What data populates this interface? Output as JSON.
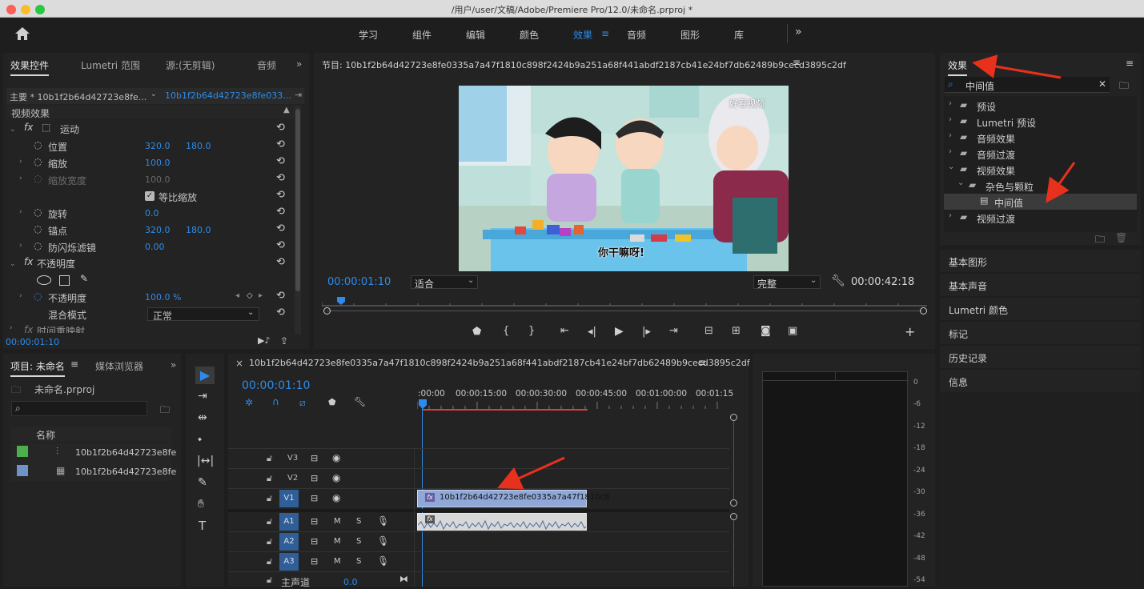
{
  "window": {
    "title": "/用户/user/文稿/Adobe/Premiere Pro/12.0/未命名.prproj *"
  },
  "workspaces": {
    "items": [
      "学习",
      "组件",
      "编辑",
      "颜色",
      "效果",
      "音频",
      "图形",
      "库"
    ],
    "active": "效果",
    "more": "»"
  },
  "effect_controls": {
    "tabs": [
      "效果控件",
      "Lumetri 范围",
      "源:(无剪辑)",
      "音频"
    ],
    "master_label": "主要 * 10b1f2b64d42723e8fe...",
    "clip_label": "10b1f2b64d42723e8fe033...",
    "video_effects": "视频效果",
    "motion": "运动",
    "position": {
      "label": "位置",
      "x": "320.0",
      "y": "180.0"
    },
    "scale": {
      "label": "缩放",
      "value": "100.0"
    },
    "scale_width": {
      "label": "缩放宽度",
      "value": "100.0"
    },
    "uniform_scale": "等比缩放",
    "rotation": {
      "label": "旋转",
      "value": "0.0"
    },
    "anchor": {
      "label": "锚点",
      "x": "320.0",
      "y": "180.0"
    },
    "flicker": {
      "label": "防闪烁滤镜",
      "value": "0.00"
    },
    "opacity_group": "不透明度",
    "opacity": {
      "label": "不透明度",
      "value": "100.0 %"
    },
    "blend": {
      "label": "混合模式",
      "value": "正常"
    },
    "time_remap": "时间重映射",
    "timecode": "00:00:01:10"
  },
  "program": {
    "title": "节目: 10b1f2b64d42723e8fe0335a7a47f1810c898f2424b9a251a68f441abdf2187cb41e24bf7db62489b9cecd3895c2df",
    "timecode": "00:00:01:10",
    "fit": "适合",
    "quality": "完整",
    "duration": "00:00:42:18",
    "subtitle": "你干嘛呀!",
    "watermark": "好看视频"
  },
  "effects_panel": {
    "title": "效果",
    "search": "中间值",
    "tree": [
      {
        "label": "预设",
        "level": 0
      },
      {
        "label": "Lumetri 预设",
        "level": 0
      },
      {
        "label": "音频效果",
        "level": 0
      },
      {
        "label": "音频过渡",
        "level": 0
      },
      {
        "label": "视频效果",
        "level": 0,
        "open": true
      },
      {
        "label": "杂色与颗粒",
        "level": 1,
        "open": true
      },
      {
        "label": "中间值",
        "level": 2,
        "selected": true
      },
      {
        "label": "视频过渡",
        "level": 0
      }
    ],
    "sections": [
      "基本图形",
      "基本声音",
      "Lumetri 颜色",
      "标记",
      "历史记录",
      "信息"
    ]
  },
  "project": {
    "tabs": [
      "项目: 未命名",
      "媒体浏览器"
    ],
    "file": "未命名.prproj",
    "col_name": "名称",
    "items": [
      {
        "name": "10b1f2b64d42723e8fe",
        "color": "#4bb04b"
      },
      {
        "name": "10b1f2b64d42723e8fe",
        "color": "#6f93c9"
      }
    ]
  },
  "timeline": {
    "title": "10b1f2b64d42723e8fe0335a7a47f1810c898f2424b9a251a68f441abdf2187cb41e24bf7db62489b9cecd3895c2df",
    "timecode": "00:00:01:10",
    "ruler": [
      ":00:00",
      "00:00:15:00",
      "00:00:30:00",
      "00:00:45:00",
      "00:01:00:00",
      "00:01:15"
    ],
    "tracks": {
      "v3": "V3",
      "v2": "V2",
      "v1": "V1",
      "a1": "A1",
      "a2": "A2",
      "a3": "A3",
      "m": "M",
      "s": "S"
    },
    "clip_label": "10b1f2b64d42723e8fe0335a7a47f1810c8",
    "master_label": "主声道",
    "master_value": "0.0"
  },
  "meter": {
    "scale": [
      "0",
      "-6",
      "-12",
      "-18",
      "-24",
      "-30",
      "-36",
      "-42",
      "-48",
      "-54"
    ]
  },
  "colors": {
    "accent": "#2d8ceb",
    "panel": "#232323",
    "bg": "#1e1e1e",
    "arrow": "#e8311d"
  }
}
